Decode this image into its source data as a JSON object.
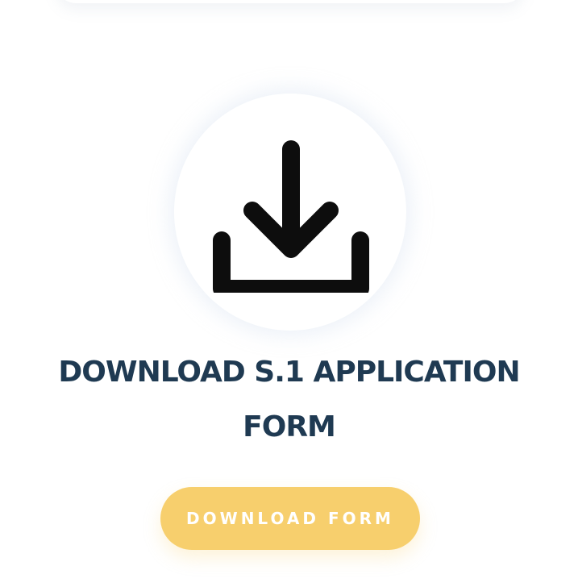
{
  "card": {
    "title": "DOWNLOAD S.1 APPLICATION FORM",
    "icon": "download-icon",
    "button_label": "DOWNLOAD FORM"
  },
  "colors": {
    "title": "#1f3a52",
    "button_background": "#f7cf6d",
    "button_text": "#ffffff",
    "icon": "#0d0d0d"
  }
}
